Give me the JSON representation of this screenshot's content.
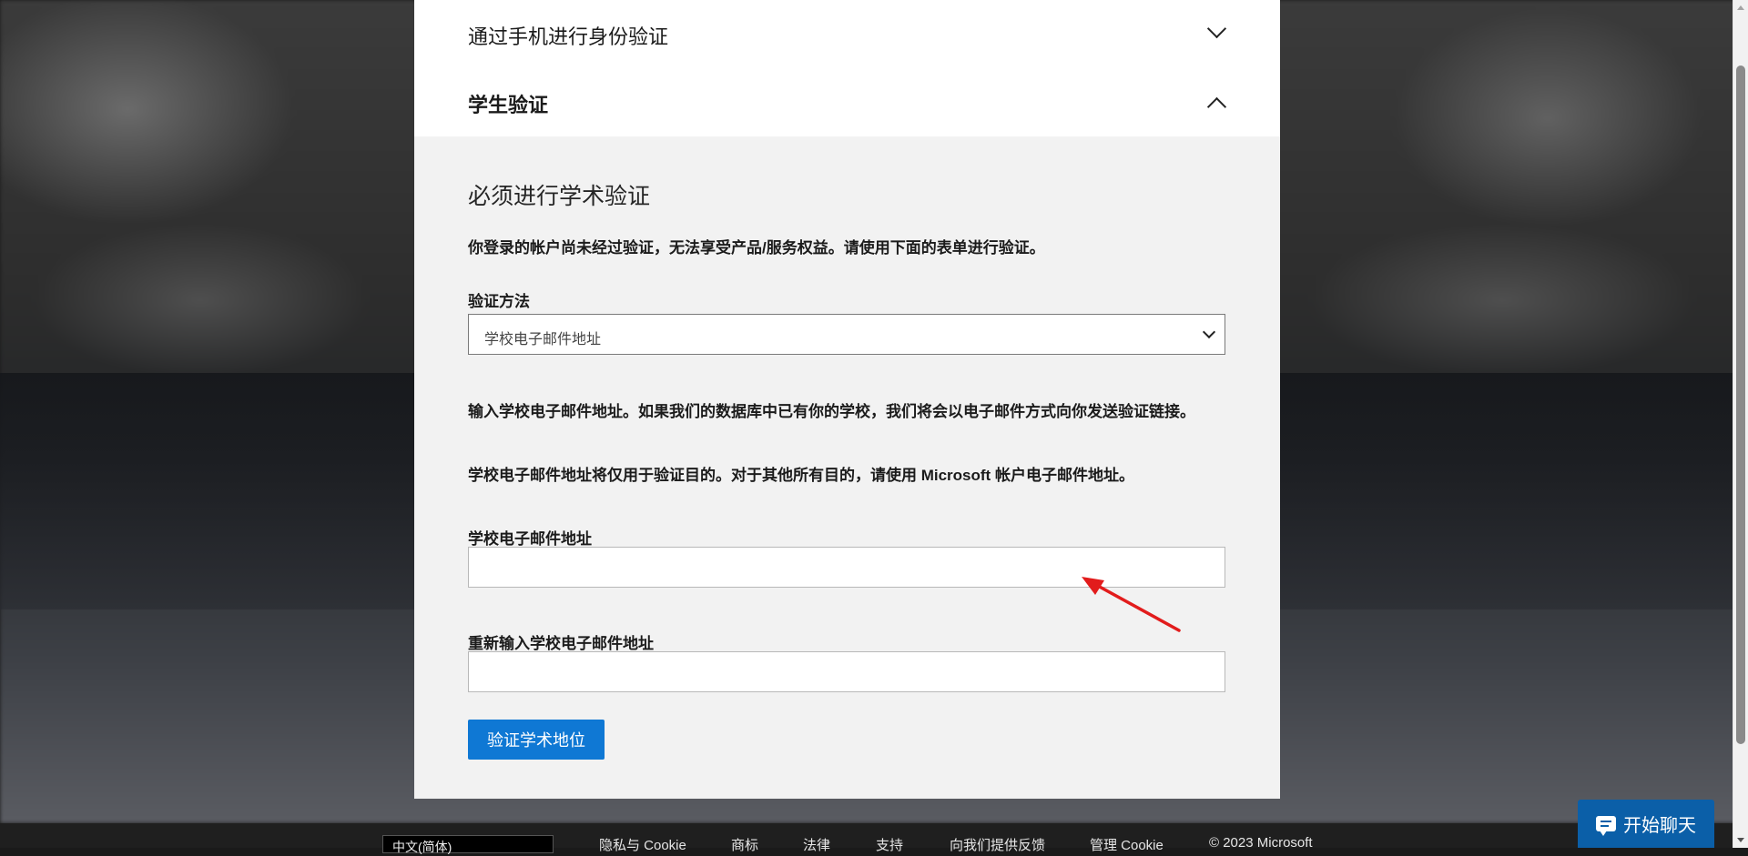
{
  "accordion": {
    "phone_title": "通过手机进行身份验证",
    "student_title": "学生验证"
  },
  "panel": {
    "heading": "必须进行学术验证",
    "intro": "你登录的帐户尚未经过验证，无法享受产品/服务权益。请使用下面的表单进行验证。",
    "method_label": "验证方法",
    "method_value": "学校电子邮件地址",
    "info_line1": "输入学校电子邮件地址。如果我们的数据库中已有你的学校，我们将会以电子邮件方式向你发送验证链接。",
    "info_line2": "学校电子邮件地址将仅用于验证目的。对于其他所有目的，请使用 Microsoft 帐户电子邮件地址。",
    "email_label": "学校电子邮件地址",
    "email_value": "",
    "confirm_label": "重新输入学校电子邮件地址",
    "confirm_value": "",
    "verify_button": "验证学术地位"
  },
  "footer": {
    "language": "中文(简体)",
    "links": [
      "隐私与 Cookie",
      "商标",
      "法律",
      "支持",
      "向我们提供反馈",
      "管理 Cookie",
      "© 2023 Microsoft"
    ]
  },
  "chat": {
    "label": "开始聊天"
  },
  "icons": {
    "phone_chevron": "chevron-down-icon",
    "student_chevron": "chevron-up-icon",
    "select_caret": "chevron-down-icon",
    "chat": "chat-bubble-icon",
    "annotation": "red-arrow-annotation"
  },
  "colors": {
    "primary_button": "#0f78d4",
    "chat_button": "#0b5fa8",
    "annotation": "#e21c1c"
  }
}
